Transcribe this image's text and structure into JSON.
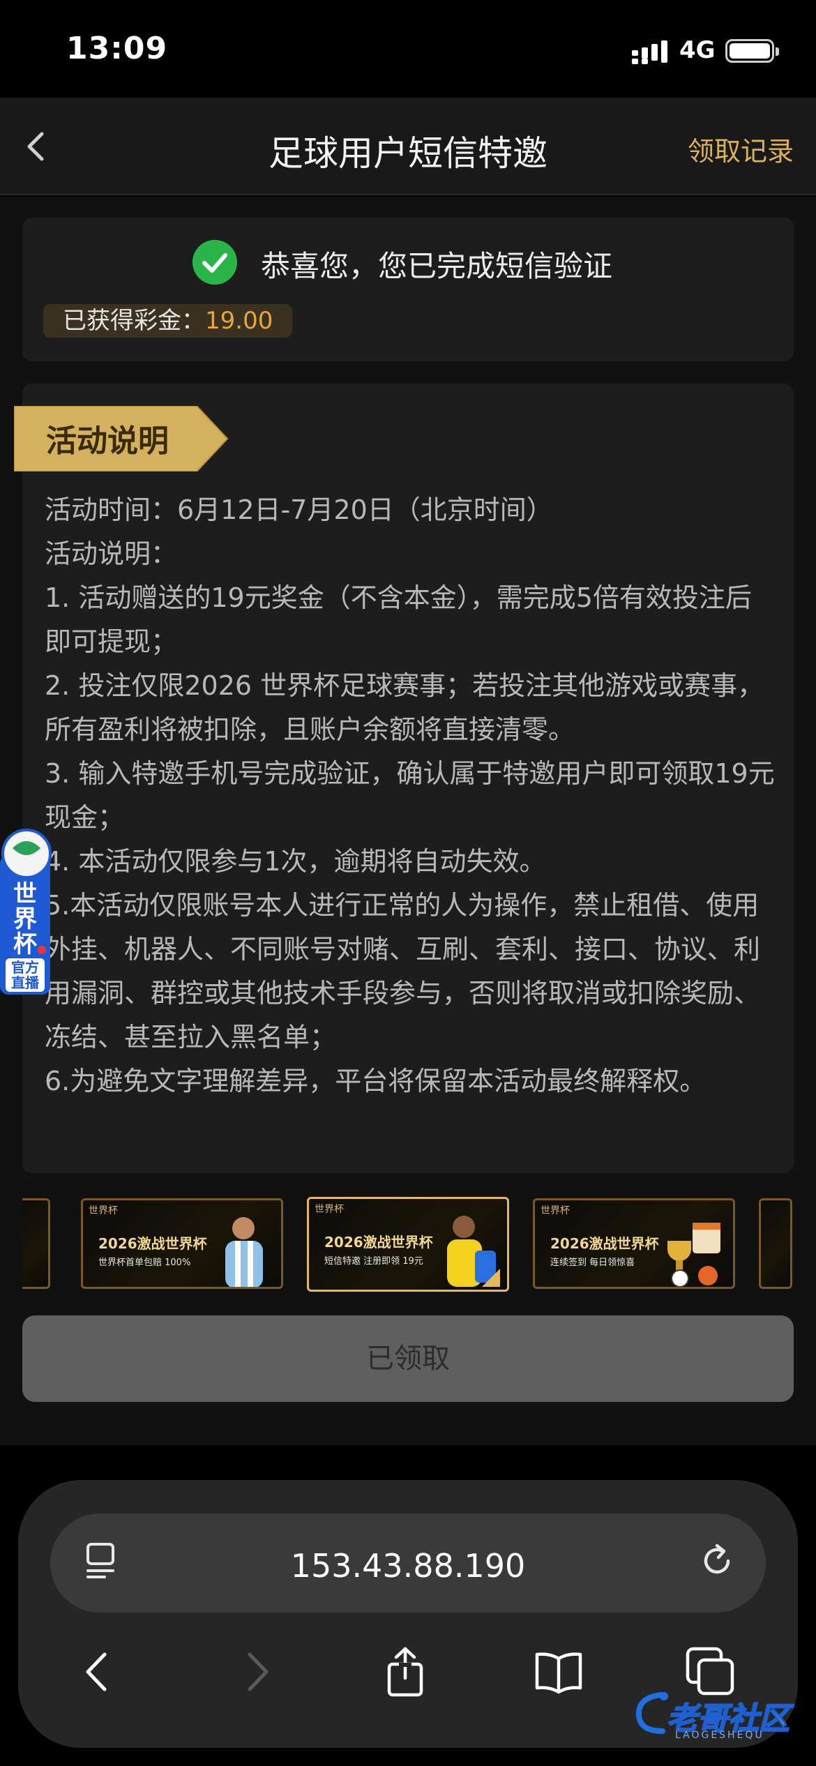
{
  "status_bar": {
    "time": "13:09",
    "network": "4G"
  },
  "nav": {
    "title": "足球用户短信特邀",
    "record_link": "领取记录"
  },
  "verify": {
    "message": "恭喜您，您已完成短信验证",
    "bonus_label": "已获得彩金：",
    "bonus_amount": "19.00"
  },
  "activity": {
    "tag": "活动说明",
    "lines": [
      "活动时间：6月12日-7月20日（北京时间）",
      "活动说明：",
      "1. 活动赠送的19元奖金（不含本金），需完成5倍有效投注后即可提现；",
      "2. 投注仅限2026 世界杯足球赛事；若投注其他游戏或赛事，所有盈利将被扣除，且账户余额将直接清零。",
      "3. 输入特邀手机号完成验证，确认属于特邀用户即可领取19元现金；",
      "4. 本活动仅限参与1次，逾期将自动失效。",
      "5.本活动仅限账号本人进行正常的人为操作，禁止租借、使用外挂、机器人、不同账号对赌、互刷、套利、接口、协议、利用漏洞、群控或其他技术手段参与，否则将取消或扣除奖励、冻结、甚至拉入黑名单；",
      "6.为避免文字理解差异，平台将保留本活动最终解释权。"
    ]
  },
  "badge": {
    "title": "世界杯",
    "sub": "官方直播"
  },
  "banners": [
    {
      "corner": "世界杯",
      "title": "2026激战世界杯",
      "sub": "世界杯首单包赔 100%"
    },
    {
      "corner": "世界杯",
      "title": "2026激战世界杯",
      "sub": "短信特邀 注册即领 19元"
    },
    {
      "corner": "世界杯",
      "title": "2026激战世界杯",
      "sub": "连续签到 每日领惊喜"
    }
  ],
  "claim_button": "已领取",
  "browser": {
    "url": "153.43.88.190"
  },
  "watermark": {
    "title": "老哥社区",
    "sub": "LAOGESHEQU"
  },
  "colors": {
    "accent_gold": "#d9b25a",
    "bonus_orange": "#e6a83a",
    "success_green": "#2bb449"
  }
}
